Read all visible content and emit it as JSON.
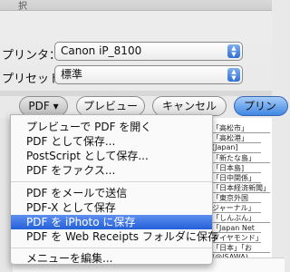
{
  "dialog": {
    "title_fragment": "択"
  },
  "printer": {
    "label": "プリンタ：",
    "value": "Canon iP_8100"
  },
  "preset": {
    "label": "プリセット：",
    "value": "標準"
  },
  "buttons": {
    "pdf_label": "PDF ▾",
    "preview_label": "プレビュー",
    "cancel_label": "キャンセル",
    "print_label": "プリン"
  },
  "menu": {
    "items": [
      "プレビューで PDF を開く",
      "PDF として保存...",
      "PostScript として保存...",
      "PDF をファクス...",
      "PDF をメールで送信",
      "PDF-X として保存",
      "PDF を iPhoto に保存",
      "PDF を Web Receipts フォルダに保存",
      "メニューを編集..."
    ],
    "selected_index": 6
  },
  "document": {
    "lines": [
      "「高松市」",
      "「高松港」",
      "[Japan]",
      "「新たな島」",
      "「日本島]",
      "「日中関係」",
      "「日本経済新聞」",
      "「東京外国",
      "ジャーナル」",
      "「しんぶん」",
      "「Japan Net",
      "ダイヤモンド」",
      "「日本」「お",
      "(@ISAWA)"
    ]
  },
  "colors": {
    "accent_blue": "#2360d8",
    "selected_text": "#ffffff"
  }
}
